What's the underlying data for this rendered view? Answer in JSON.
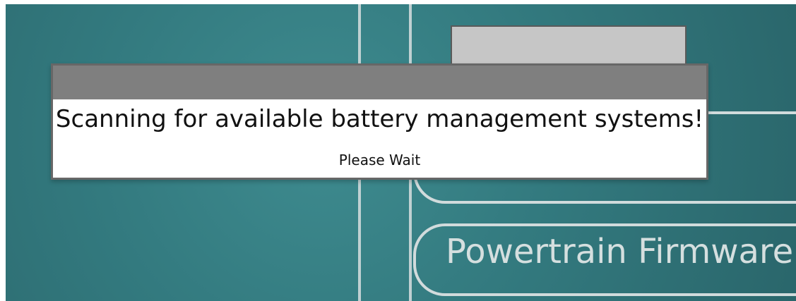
{
  "background": {
    "top_left_label": "",
    "top_right_label": "",
    "buttons": [
      {
        "label": ""
      },
      {
        "label": "Powertrain Firmware"
      }
    ]
  },
  "dialog": {
    "message": "Scanning for available battery management systems!",
    "submessage": "Please Wait"
  }
}
